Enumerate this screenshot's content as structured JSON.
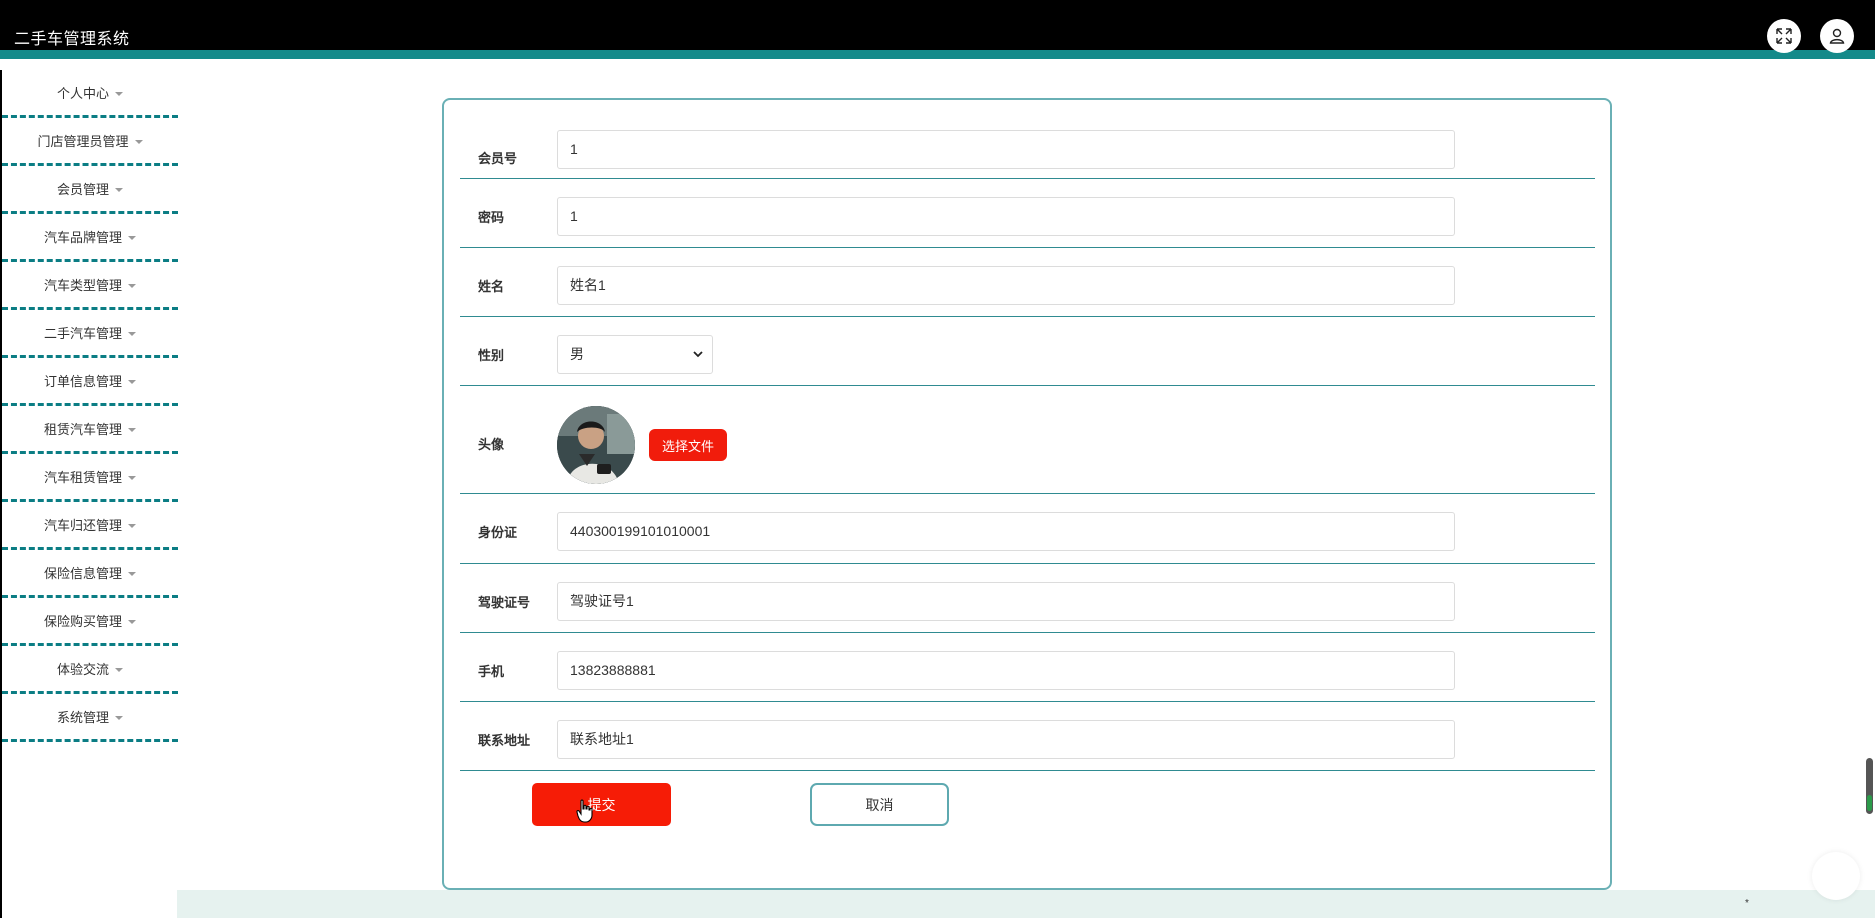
{
  "header": {
    "app_title": "二手车管理系统",
    "icons": [
      "fullscreen-icon",
      "user-icon"
    ]
  },
  "sidebar": {
    "items": [
      {
        "label": "个人中心"
      },
      {
        "label": "门店管理员管理"
      },
      {
        "label": "会员管理"
      },
      {
        "label": "汽车品牌管理"
      },
      {
        "label": "汽车类型管理"
      },
      {
        "label": "二手汽车管理"
      },
      {
        "label": "订单信息管理"
      },
      {
        "label": "租赁汽车管理"
      },
      {
        "label": "汽车租赁管理"
      },
      {
        "label": "汽车归还管理"
      },
      {
        "label": "保险信息管理"
      },
      {
        "label": "保险购买管理"
      },
      {
        "label": "体验交流"
      },
      {
        "label": "系统管理"
      }
    ]
  },
  "form": {
    "member_no": {
      "label": "会员号",
      "value": "1"
    },
    "password": {
      "label": "密码",
      "value": "1"
    },
    "name": {
      "label": "姓名",
      "value": "姓名1"
    },
    "gender": {
      "label": "性别",
      "value": "男"
    },
    "avatar": {
      "label": "头像",
      "button": "选择文件"
    },
    "id_card": {
      "label": "身份证",
      "value": "440300199101010001"
    },
    "license": {
      "label": "驾驶证号",
      "value": "驾驶证号1"
    },
    "phone": {
      "label": "手机",
      "value": "13823888881"
    },
    "address": {
      "label": "联系地址",
      "value": "联系地址1"
    },
    "submit_label": "提交",
    "cancel_label": "取消"
  },
  "footer": {
    "mark": "*"
  },
  "colors": {
    "header_bg": "#000000",
    "accent_teal": "#148a8a",
    "button_red": "#f61c06",
    "footer_bg": "#e6f2ef"
  }
}
